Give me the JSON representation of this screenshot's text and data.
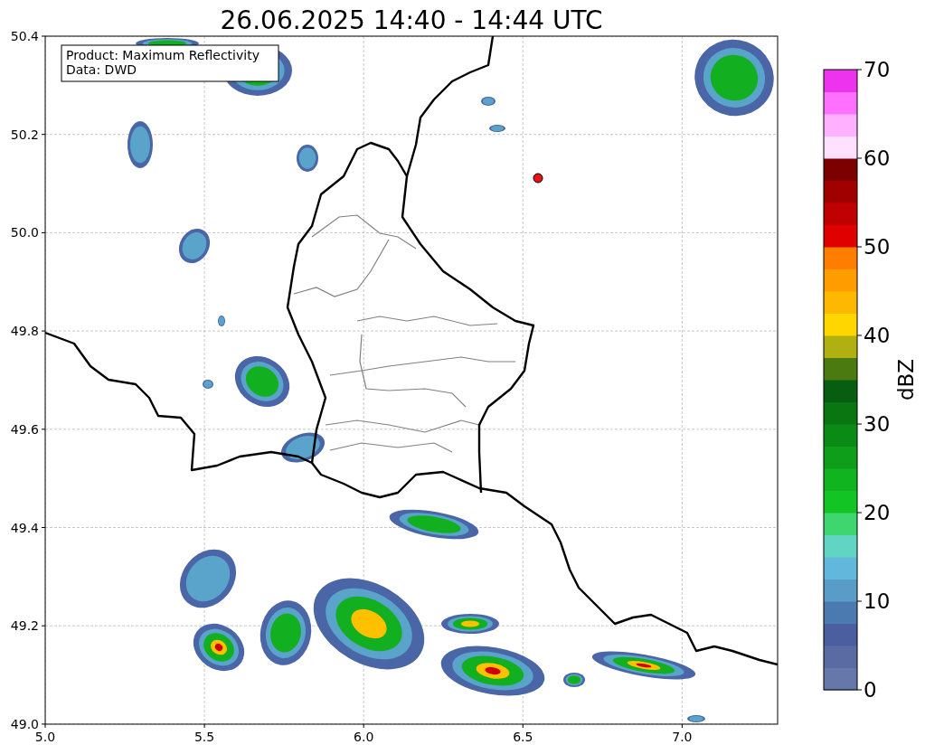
{
  "title": "26.06.2025 14:40 - 14:44 UTC",
  "info_box": {
    "lines": [
      "Product: Maximum Reflectivity",
      "Data: DWD"
    ]
  },
  "map": {
    "x_ticks": [
      "5.0",
      "5.5",
      "6.0",
      "6.5",
      "7.0"
    ],
    "y_ticks": [
      "50.4",
      "50.2",
      "50.0",
      "49.8",
      "49.6",
      "49.4",
      "49.2",
      "49.0"
    ]
  },
  "colorbar": {
    "label": "dBZ",
    "ticks": [
      "70",
      "60",
      "50",
      "40",
      "30",
      "20",
      "10",
      "0"
    ],
    "segments": [
      {
        "color": "#6677aa"
      },
      {
        "color": "#5a6aa2"
      },
      {
        "color": "#4a5ea0"
      },
      {
        "color": "#4a7ab0"
      },
      {
        "color": "#5a9cc8"
      },
      {
        "color": "#62b8dc"
      },
      {
        "color": "#62d4c4"
      },
      {
        "color": "#3ed66e"
      },
      {
        "color": "#12c424"
      },
      {
        "color": "#10b41e"
      },
      {
        "color": "#0e9e1a"
      },
      {
        "color": "#0c8a16"
      },
      {
        "color": "#0a7612"
      },
      {
        "color": "#085e10"
      },
      {
        "color": "#4a7a10"
      },
      {
        "color": "#b0b010"
      },
      {
        "color": "#ffd600"
      },
      {
        "color": "#ffb800"
      },
      {
        "color": "#ff9c00"
      },
      {
        "color": "#ff7e00"
      },
      {
        "color": "#e00000"
      },
      {
        "color": "#c00000"
      },
      {
        "color": "#a00000"
      },
      {
        "color": "#7c0000"
      },
      {
        "color": "#ffe0ff"
      },
      {
        "color": "#ffb0ff"
      },
      {
        "color": "#ff70ff"
      },
      {
        "color": "#ee33ee"
      }
    ]
  }
}
